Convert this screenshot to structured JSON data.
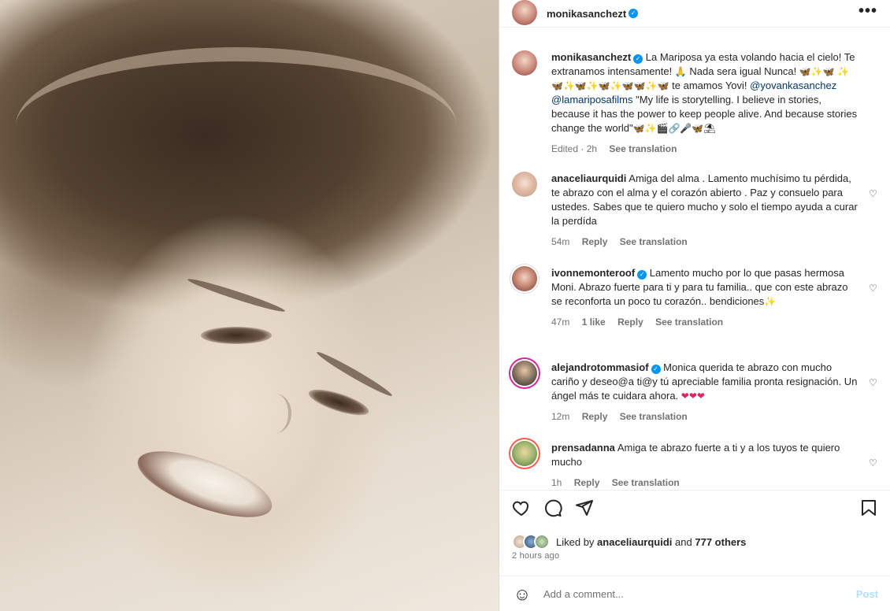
{
  "post": {
    "username": "monikasanchezt",
    "more_label": "•••"
  },
  "caption": {
    "username": "monikasanchezt",
    "line1": "La Mariposa ya esta volando hacia el cielo! Te extranamos intensamente!",
    "line1b": "Nada sera igual Nunca!",
    "line2": "te amamos Yovi!",
    "mention1": "@yovankasanchez",
    "mention2": "@lamariposafilms",
    "quote": "\"My life is storytelling. I believe in stories, because it has the power to keep people alive. And because stories change the world\"",
    "meta_time": "Edited · 2h",
    "meta_translate": "See translation"
  },
  "comments": [
    {
      "username": "anaceliaurquidi",
      "text": "Amiga del alma . Lamento muchísimo tu pérdida, te abrazo con el alma y el corazón abierto . Paz y consuelo para ustedes. Sabes que te quiero mucho y solo el tiempo ayuda a curar la perdída",
      "time": "54m",
      "reply": "Reply",
      "translate": "See translation"
    },
    {
      "username": "ivonnemonteroof",
      "text": "Lamento mucho por lo que pasas hermosa Moni. Abrazo fuerte para ti y para tu familia.. que con este abrazo se reconforta un poco tu corazón.. bendiciones",
      "time": "47m",
      "likes": "1 like",
      "reply": "Reply",
      "translate": "See translation"
    },
    {
      "username": "alejandrotommasiof",
      "text": "Monica querida te abrazo con mucho cariño y deseo@a ti@y tú apreciable familia pronta resignación. Un ángel más te cuidara ahora.",
      "time": "12m",
      "reply": "Reply",
      "translate": "See translation"
    },
    {
      "username": "prensadanna",
      "text": "Amiga te abrazo fuerte a ti y a los tuyos te quiero mucho",
      "time": "1h",
      "reply": "Reply",
      "translate": "See translation"
    }
  ],
  "likes": {
    "prefix": "Liked by",
    "user": "anaceliaurquidi",
    "and": "and",
    "others": "777 others"
  },
  "posted_ago": "2 hours ago",
  "add_comment": {
    "placeholder": "Add a comment...",
    "post_label": "Post"
  },
  "icons": {
    "like": "heart-icon",
    "comment": "comment-icon",
    "share": "share-icon",
    "save": "bookmark-icon",
    "emoji": "emoji-icon",
    "verified": "verified-badge-icon"
  },
  "colors": {
    "link": "#00376b",
    "verified": "#0095f6",
    "muted": "#737373",
    "post_disabled": "#b2dffc"
  }
}
